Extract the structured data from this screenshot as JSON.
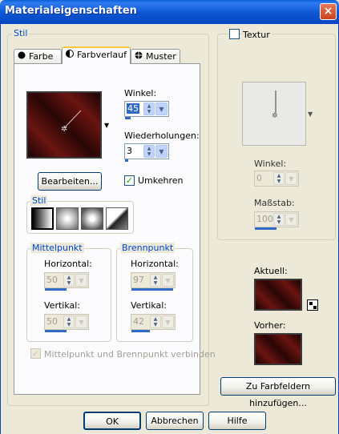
{
  "window": {
    "title": "Materialeigenschaften",
    "close_label": "×"
  },
  "stil_group": {
    "title": "Stil"
  },
  "tabs": [
    {
      "label": "Farbe",
      "icon": "circle-icon"
    },
    {
      "label": "Farbverlauf",
      "icon": "half-circle-icon"
    },
    {
      "label": "Muster",
      "icon": "pattern-icon"
    }
  ],
  "gradient": {
    "angle_label": "Winkel:",
    "angle_value": "45",
    "angle_fraction": 0.125,
    "repeats_label": "Wiederholungen:",
    "repeats_value": "3",
    "repeats_fraction": 0.03,
    "edit_button": "Bearbeiten...",
    "reverse_label": "Umkehren",
    "reverse_checked": true
  },
  "style_subgroup": {
    "title": "Stil"
  },
  "midpoint": {
    "title": "Mittelpunkt",
    "horizontal_label": "Horizontal:",
    "horizontal_value": "50",
    "horizontal_fraction": 0.5,
    "vertical_label": "Vertikal:",
    "vertical_value": "50",
    "vertical_fraction": 0.5
  },
  "focalpoint": {
    "title": "Brennpunkt",
    "horizontal_label": "Horizontal:",
    "horizontal_value": "97",
    "horizontal_fraction": 0.97,
    "vertical_label": "Vertikal:",
    "vertical_value": "42",
    "vertical_fraction": 0.42
  },
  "link_label": "Mittelpunkt und Brennpunkt verbinden",
  "texture": {
    "label": "Textur",
    "angle_label": "Winkel:",
    "angle_value": "0",
    "scale_label": "Maßstab:",
    "scale_value": "100",
    "scale_fraction": 0.5
  },
  "current_label": "Aktuell:",
  "previous_label": "Vorher:",
  "add_swatch_button": "Zu Farbfeldern hinzufügen...",
  "buttons": {
    "ok": "OK",
    "cancel": "Abbrechen",
    "help": "Hilfe"
  },
  "colors": {
    "accent": "#316ac5",
    "title_blue": "#0046d5",
    "dark_red": "#6a1410"
  }
}
